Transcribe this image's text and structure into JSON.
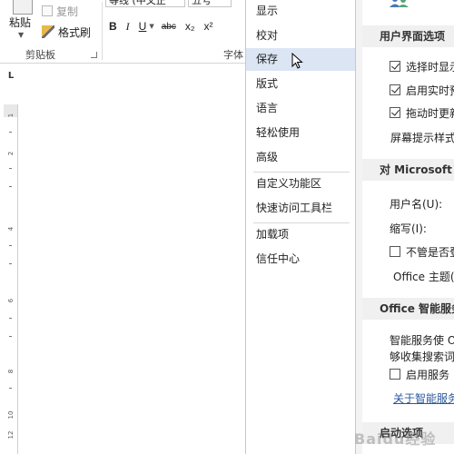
{
  "clipboard": {
    "paste_label": "粘贴",
    "copy_label": "复制",
    "format_painter_label": "格式刷",
    "group_label": "剪贴板"
  },
  "font_group": {
    "font_name": "等线 (中文正",
    "font_size": "五号",
    "bold": "B",
    "italic": "I",
    "underline": "U",
    "strikethrough": "abc",
    "subscript": "x₂",
    "superscript": "x²",
    "group_label": "字体"
  },
  "ruler": {
    "corner": "L",
    "marks": [
      "1",
      "2",
      "4",
      "6",
      "8",
      "10",
      "12"
    ]
  },
  "options_nav": {
    "items": [
      {
        "label": "显示",
        "selected": false
      },
      {
        "label": "校对",
        "selected": false
      },
      {
        "label": "保存",
        "selected": true
      },
      {
        "label": "版式",
        "selected": false
      },
      {
        "label": "语言",
        "selected": false
      },
      {
        "label": "轻松使用",
        "selected": false
      },
      {
        "label": "高级",
        "selected": false
      },
      {
        "label": "自定义功能区",
        "selected": false
      },
      {
        "label": "快速访问工具栏",
        "selected": false
      },
      {
        "label": "加载项",
        "selected": false
      },
      {
        "label": "信任中心",
        "selected": false
      }
    ]
  },
  "options_panel": {
    "ui_section": {
      "header": "用户界面选项",
      "options": [
        {
          "label": "选择时显示",
          "checked": true
        },
        {
          "label": "启用实时预",
          "checked": true
        },
        {
          "label": "拖动时更新",
          "checked": true
        }
      ],
      "screentip_label": "屏幕提示样式"
    },
    "personalize_section": {
      "header": "对 Microsoft O",
      "username_label": "用户名(U):",
      "initials_label": "缩写(I):",
      "always_use_label": "不管是否登",
      "always_use_checked": false,
      "theme_label": "Office 主题(T"
    },
    "intelligent_section": {
      "header": "Office 智能服务",
      "desc_line1": "智能服务使 O",
      "desc_line2": "够收集搜索词",
      "enable_label": "启用服务",
      "enable_checked": false,
      "about_link": "关于智能服务"
    },
    "startup_section": {
      "header": "启动选项"
    }
  },
  "watermark": "Baidu经验",
  "colors": {
    "selected_nav": "#dbe5f3",
    "section_header_bg": "#f0f0f0",
    "link": "#2b579a"
  }
}
